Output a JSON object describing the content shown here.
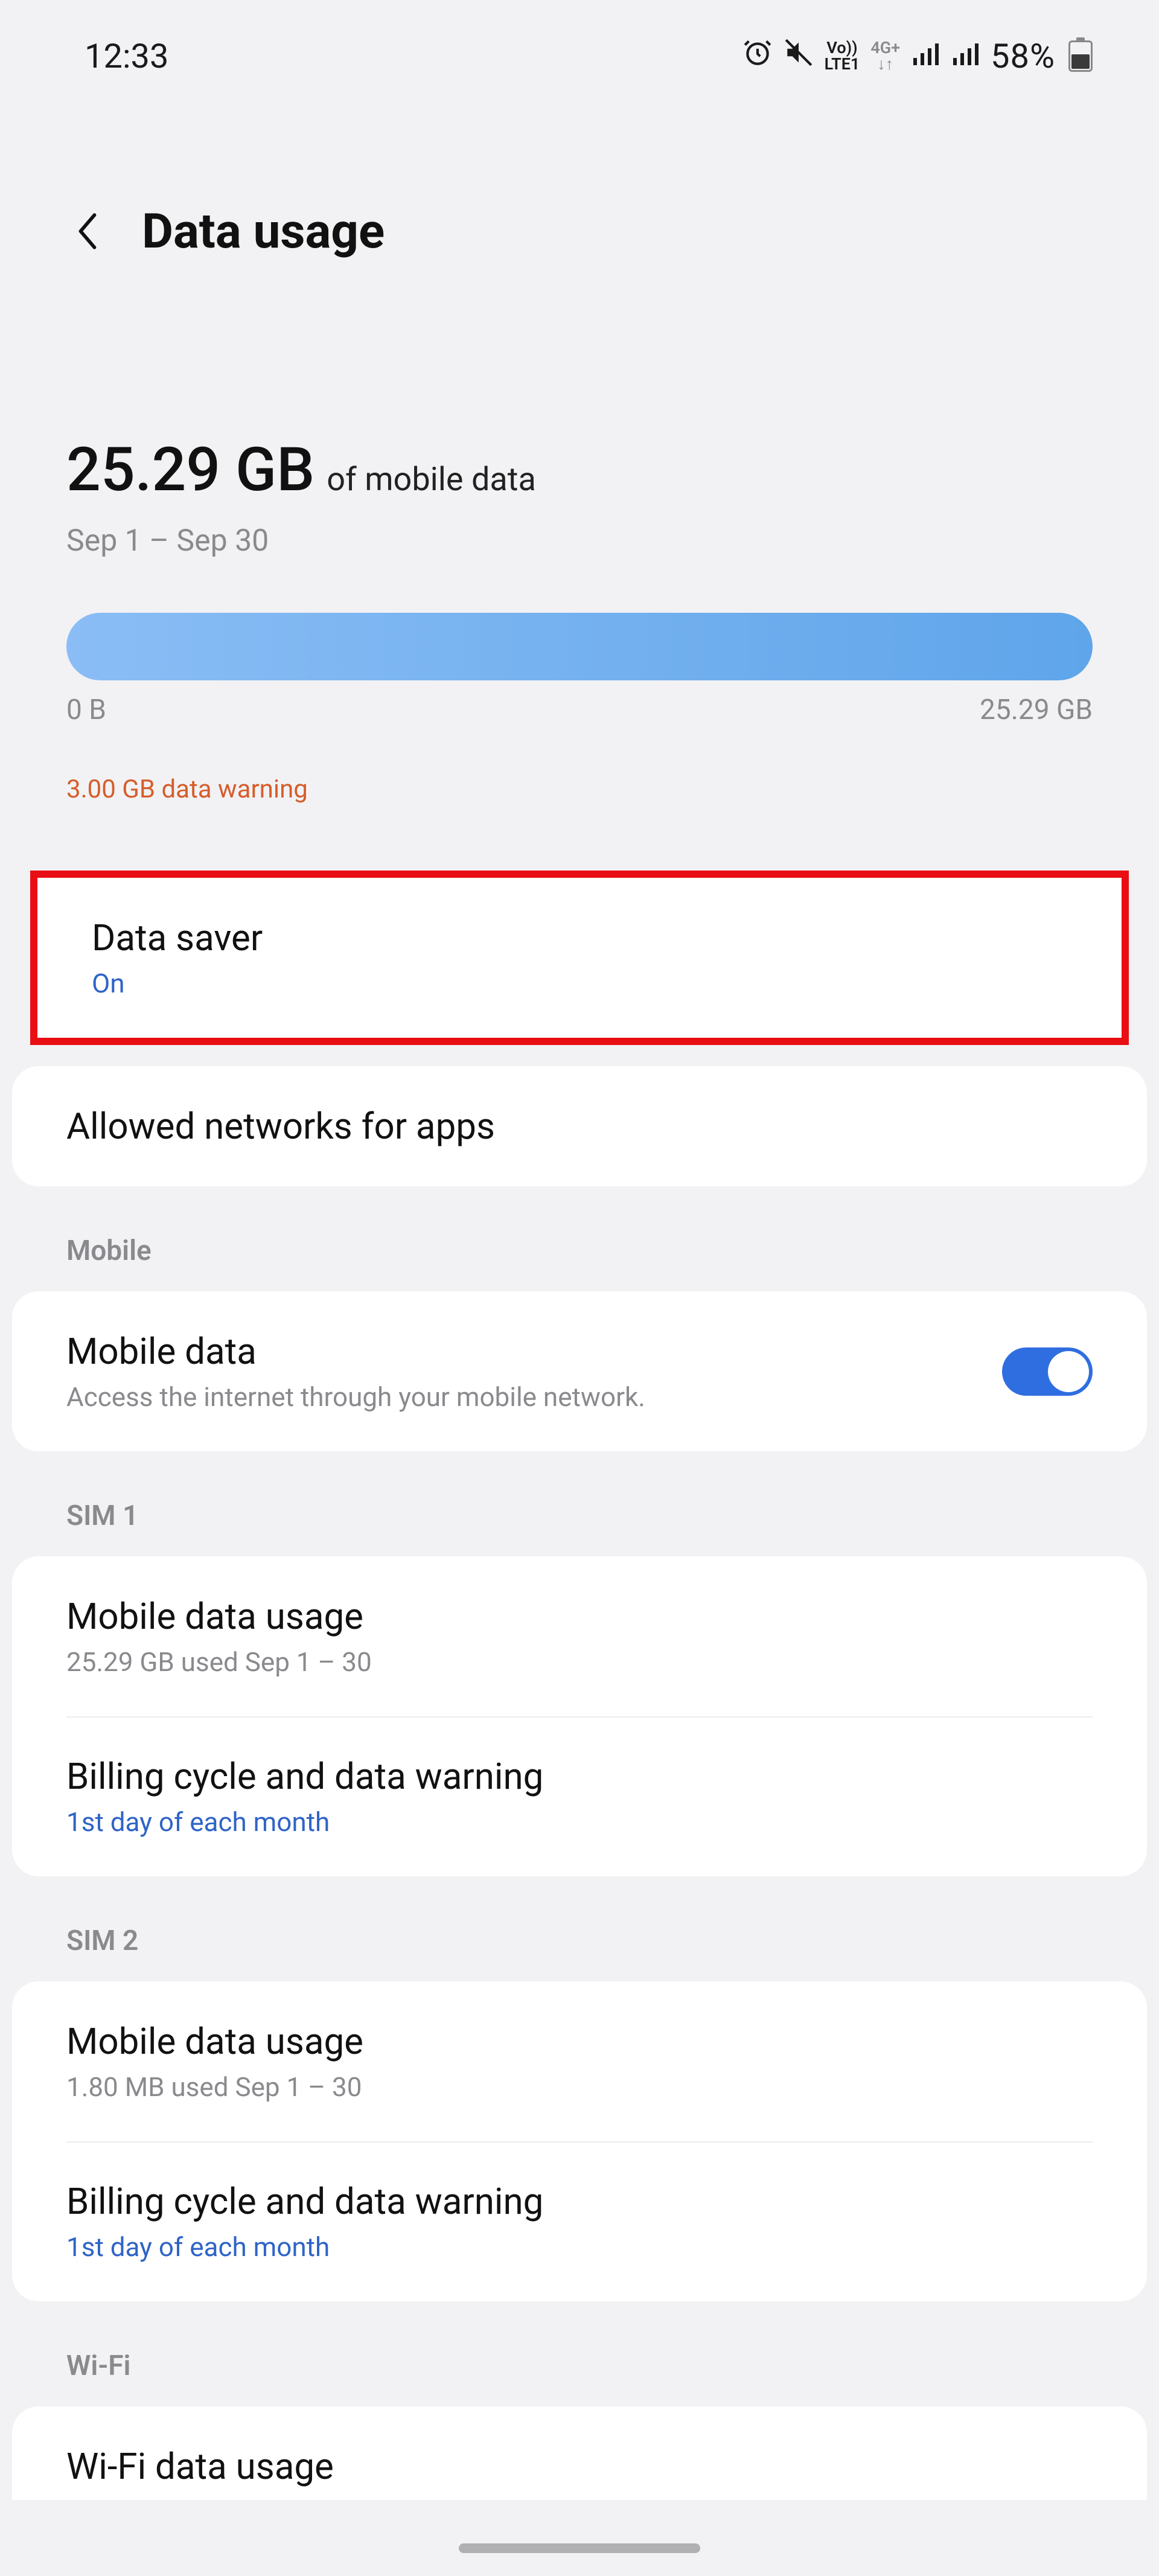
{
  "status": {
    "time": "12:33",
    "volte_top": "Vo))",
    "volte_bottom": "LTE1",
    "net_top": "4G+",
    "net_bottom": "↓↑",
    "battery_pct": "58%"
  },
  "header": {
    "title": "Data usage"
  },
  "summary": {
    "amount": "25.29 GB",
    "label": "of mobile data",
    "period": "Sep 1 – Sep 30",
    "min_label": "0 B",
    "max_label": "25.29 GB",
    "warning": "3.00 GB data warning"
  },
  "data_saver": {
    "title": "Data saver",
    "status": "On"
  },
  "allowed_networks": {
    "title": "Allowed networks for apps"
  },
  "sections": {
    "mobile": "Mobile",
    "sim1": "SIM 1",
    "sim2": "SIM 2",
    "wifi": "Wi-Fi"
  },
  "mobile_data": {
    "title": "Mobile data",
    "subtitle": "Access the internet through your mobile network.",
    "enabled": true
  },
  "sim1": {
    "usage_title": "Mobile data usage",
    "usage_sub": "25.29 GB used Sep 1 – 30",
    "billing_title": "Billing cycle and data warning",
    "billing_sub": "1st day of each month"
  },
  "sim2": {
    "usage_title": "Mobile data usage",
    "usage_sub": "1.80 MB used Sep 1 – 30",
    "billing_title": "Billing cycle and data warning",
    "billing_sub": "1st day of each month"
  },
  "wifi": {
    "usage_title": "Wi-Fi data usage"
  }
}
